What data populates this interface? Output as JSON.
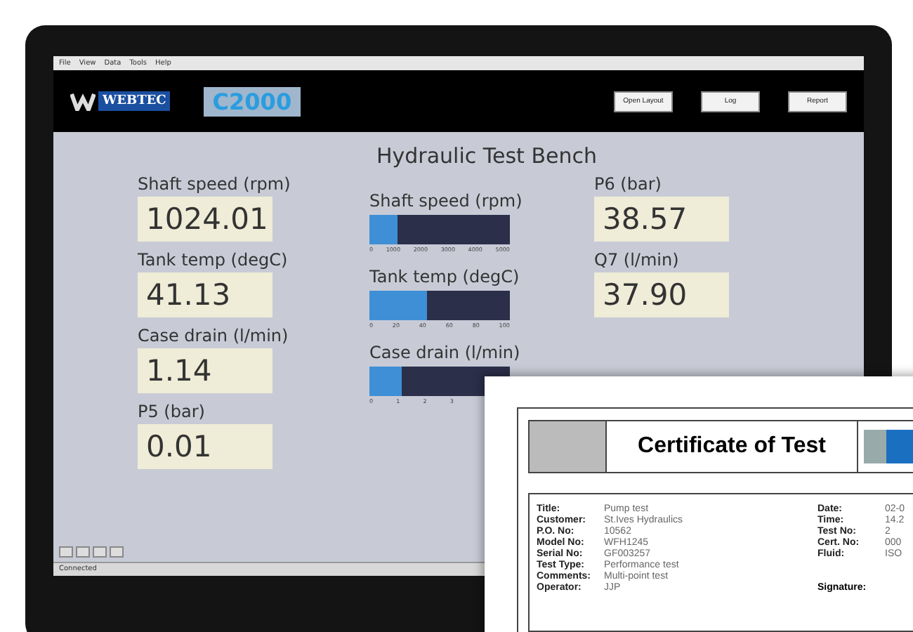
{
  "menu": [
    "File",
    "View",
    "Data",
    "Tools",
    "Help"
  ],
  "header": {
    "logo_text": "WEBTEC",
    "product": "C2000",
    "buttons": [
      "Open Layout",
      "Log",
      "Report"
    ]
  },
  "title": "Hydraulic Test Bench",
  "readouts_left": [
    {
      "label": "Shaft speed (rpm)",
      "value": "1024.01"
    },
    {
      "label": "Tank temp (degC)",
      "value": "41.13"
    },
    {
      "label": "Case drain (l/min)",
      "value": "1.14"
    },
    {
      "label": "P5 (bar)",
      "value": "0.01"
    }
  ],
  "gauges": [
    {
      "label": "Shaft speed (rpm)",
      "level": 0.2,
      "ticks": [
        "0",
        "1000",
        "2000",
        "3000",
        "4000",
        "5000"
      ]
    },
    {
      "label": "Tank temp (degC)",
      "level": 0.41,
      "ticks": [
        "0",
        "20",
        "40",
        "60",
        "80",
        "100"
      ]
    },
    {
      "label": "Case drain (l/min)",
      "level": 0.23,
      "ticks": [
        "0",
        "1",
        "2",
        "3"
      ]
    }
  ],
  "readouts_right": [
    {
      "label": "P6 (bar)",
      "value": "38.57"
    },
    {
      "label": "Q7 (l/min)",
      "value": "37.90"
    }
  ],
  "status_bar": "Connected",
  "certificate": {
    "title": "Certificate of Test",
    "left_fields": [
      {
        "label": "Title:",
        "value": "Pump test"
      },
      {
        "label": "Customer:",
        "value": "St.Ives Hydraulics"
      },
      {
        "label": "P.O. No:",
        "value": "10562"
      },
      {
        "label": "Model No:",
        "value": "WFH1245"
      },
      {
        "label": "Serial No:",
        "value": "GF003257"
      },
      {
        "label": "Test Type:",
        "value": "Performance test"
      },
      {
        "label": "Comments:",
        "value": "Multi-point test"
      },
      {
        "label": "Operator:",
        "value": "JJP"
      }
    ],
    "right_fields": [
      {
        "label": "Date:",
        "value": "02-0"
      },
      {
        "label": "Time:",
        "value": "14.2"
      },
      {
        "label": "Test No:",
        "value": "2"
      },
      {
        "label": "Cert. No:",
        "value": "000"
      },
      {
        "label": "Fluid:",
        "value": "ISO"
      }
    ],
    "signature_label": "Signature:"
  }
}
